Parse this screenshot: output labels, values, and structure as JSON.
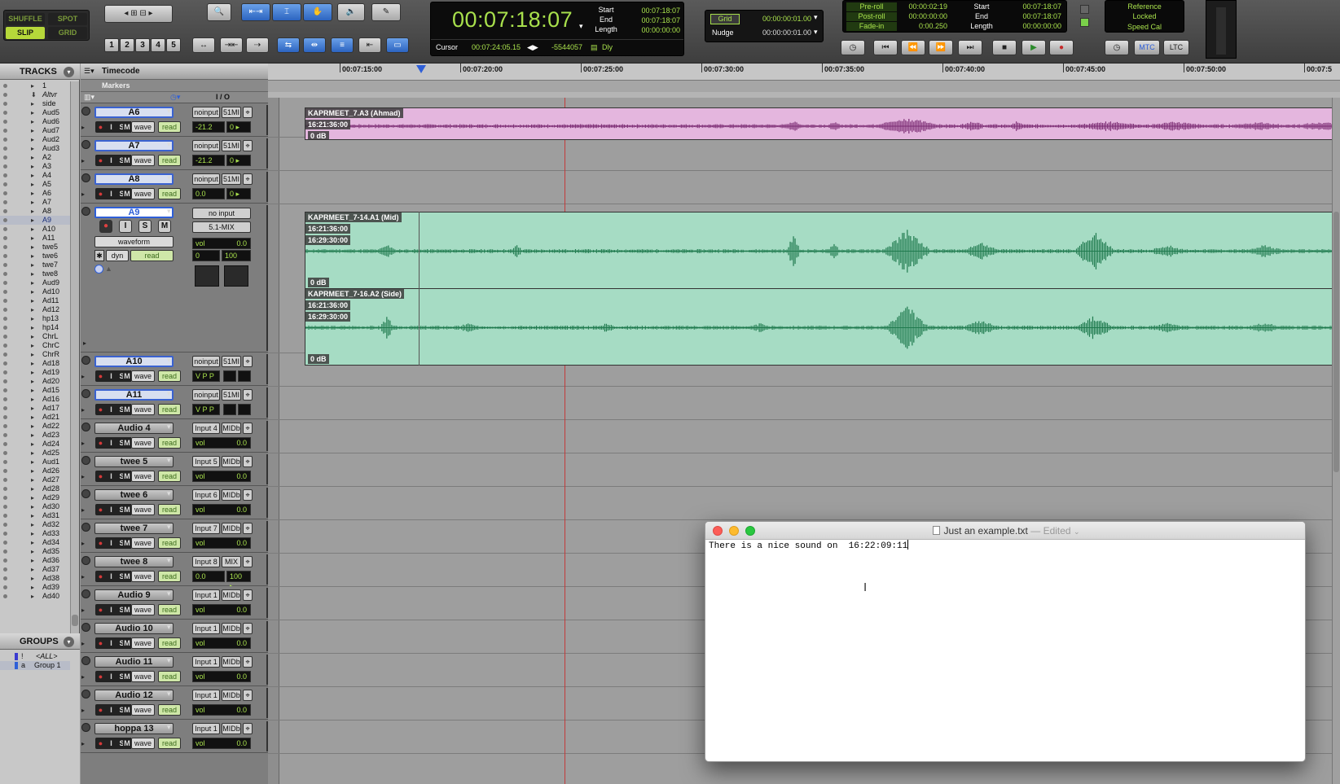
{
  "modes": {
    "shuffle": "SHUFFLE",
    "spot": "SPOT",
    "slip": "SLIP",
    "grid": "GRID"
  },
  "zoom_presets": [
    "1",
    "2",
    "3",
    "4",
    "5"
  ],
  "counter": {
    "main": "00:07:18:07",
    "start_label": "Start",
    "start": "00:07:18:07",
    "end_label": "End",
    "end": "00:07:18:07",
    "length_label": "Length",
    "length": "00:00:00:00",
    "cursor_label": "Cursor",
    "cursor": "00:07:24:05.15",
    "cursor_samples": "-5544057",
    "dly_label": "Dly"
  },
  "grid_nudge": {
    "grid_label": "Grid",
    "grid_value": "00:00:00:01.00",
    "nudge_label": "Nudge",
    "nudge_value": "00:00:00:01.00"
  },
  "preroll": {
    "pre_label": "Pre-roll",
    "pre": "00:00:02:19",
    "post_label": "Post-roll",
    "post": "00:00:00:00",
    "fade_label": "Fade-in",
    "fade": "0:00.250",
    "start_label": "Start",
    "start": "00:07:18:07",
    "end_label": "End",
    "end": "00:07:18:07",
    "length_label": "Length",
    "length": "00:00:00:00"
  },
  "reference": {
    "line1": "Reference",
    "line2": "Locked",
    "line3": "Speed Cal"
  },
  "sync": {
    "mtc": "MTC",
    "ltc": "LTC"
  },
  "tracks_pane": {
    "title": "TRACKS",
    "items": [
      "1",
      "Altvr",
      "side",
      "Aud5",
      "Aud6",
      "Aud7",
      "Aud2",
      "Aud3",
      "A2",
      "A3",
      "A4",
      "A5",
      "A6",
      "A7",
      "A8",
      "A9",
      "A10",
      "A11",
      "twe5",
      "twe6",
      "twe7",
      "twe8",
      "Aud9",
      "Ad10",
      "Ad11",
      "Ad12",
      "hp13",
      "hp14",
      "ChrL",
      "ChrC",
      "ChrR",
      "Ad18",
      "Ad19",
      "Ad20",
      "Ad15",
      "Ad16",
      "Ad17",
      "Ad21",
      "Ad22",
      "Ad23",
      "Ad24",
      "Ad25",
      "Aud1",
      "Ad26",
      "Ad27",
      "Ad28",
      "Ad29",
      "Ad30",
      "Ad31",
      "Ad32",
      "Ad33",
      "Ad34",
      "Ad35",
      "Ad36",
      "Ad37",
      "Ad38",
      "Ad39",
      "Ad40"
    ],
    "selected": "A9"
  },
  "groups_pane": {
    "title": "GROUPS",
    "all": "<ALL>",
    "group1_id": "a",
    "group1": "Group 1",
    "all_id": "!"
  },
  "ruler": {
    "timecode_label": "Timecode",
    "markers_label": "Markers",
    "ticks": [
      "00:07:15:00",
      "00:07:20:00",
      "00:07:25:00",
      "00:07:30:00",
      "00:07:35:00",
      "00:07:40:00",
      "00:07:45:00",
      "00:07:50:00",
      "00:07:5"
    ]
  },
  "io_header": "I / O",
  "tracks": [
    {
      "name": "A6",
      "input": "noinput",
      "output": "51MI",
      "vol": "-21.2",
      "pan": "0",
      "view": "wave",
      "auto": "read"
    },
    {
      "name": "A7",
      "input": "noinput",
      "output": "51MI",
      "vol": "-21.2",
      "pan": "0",
      "view": "wave",
      "auto": "read"
    },
    {
      "name": "A8",
      "input": "noinput",
      "output": "51MI",
      "vol": "0.0",
      "pan": "0",
      "view": "wave",
      "auto": "read"
    },
    {
      "name": "A9",
      "input": "no input",
      "output": "5.1-MIX",
      "vol_label": "vol",
      "vol": "0.0",
      "pan": "0",
      "pan2": "100",
      "view": "waveform",
      "dyn": "dyn",
      "auto": "read",
      "btns": [
        "I",
        "S",
        "M"
      ]
    },
    {
      "name": "A10",
      "input": "noinput",
      "output": "51MI",
      "vpp": "V P P",
      "view": "wave",
      "auto": "read"
    },
    {
      "name": "A11",
      "input": "noinput",
      "output": "51MI",
      "vpp": "V P P",
      "view": "wave",
      "auto": "read"
    },
    {
      "name": "Audio 4",
      "input": "Input 4",
      "output": "MIDb",
      "vol_label": "vol",
      "vol": "0.0",
      "view": "wave",
      "auto": "read"
    },
    {
      "name": "twee 5",
      "input": "Input 5",
      "output": "MIDb",
      "vol_label": "vol",
      "vol": "0.0",
      "view": "wave",
      "auto": "read"
    },
    {
      "name": "twee 6",
      "input": "Input 6",
      "output": "MIDb",
      "vol_label": "vol",
      "vol": "0.0",
      "view": "wave",
      "auto": "read"
    },
    {
      "name": "twee 7",
      "input": "Input 7",
      "output": "MIDb",
      "vol_label": "vol",
      "vol": "0.0",
      "view": "wave",
      "auto": "read"
    },
    {
      "name": "twee 8",
      "input": "Input 8",
      "output": "MIX",
      "vol": "0.0",
      "pan2": "100",
      "view": "wave",
      "auto": "read"
    },
    {
      "name": "Audio 9",
      "input": "Input 1",
      "output": "MIDb",
      "vol_label": "vol",
      "vol": "0.0",
      "view": "wave",
      "auto": "read"
    },
    {
      "name": "Audio 10",
      "input": "Input 1",
      "output": "MIDb",
      "vol_label": "vol",
      "vol": "0.0",
      "view": "wave",
      "auto": "read"
    },
    {
      "name": "Audio 11",
      "input": "Input 1",
      "output": "MIDb",
      "vol_label": "vol",
      "vol": "0.0",
      "view": "wave",
      "auto": "read"
    },
    {
      "name": "Audio 12",
      "input": "Input 1",
      "output": "MIDb",
      "vol_label": "vol",
      "vol": "0.0",
      "view": "wave",
      "auto": "read"
    },
    {
      "name": "hoppa 13",
      "input": "Input 1",
      "output": "MIDb",
      "vol_label": "vol",
      "vol": "0.0",
      "view": "wave",
      "auto": "read"
    }
  ],
  "clips": {
    "a6": {
      "name": "KAPRMEET_7.A3 (Ahmad)",
      "tc": "16:21:36:00",
      "db": "0 dB"
    },
    "mid": {
      "name": "KAPRMEET_7-14.A1 (Mid)",
      "tc1": "16:21:36:00",
      "tc2": "16:29:30:00",
      "db": "0 dB"
    },
    "side": {
      "name": "KAPRMEET_7-16.A2 (Side)",
      "tc1": "16:21:36:00",
      "tc2": "16:29:30:00",
      "db": "0 dB"
    }
  },
  "textedit": {
    "filename": "Just an example.txt",
    "status": "— Edited",
    "content": "There is a nice sound on  16:22:09:11"
  },
  "colors": {
    "counter_green": "#a8e04c",
    "clip_pink": "#e4b6de",
    "clip_green": "#a6dcc4",
    "wave_green": "#1f7a4e",
    "wave_purple": "#7a2a72",
    "selection_blue": "#2e5fd8"
  }
}
